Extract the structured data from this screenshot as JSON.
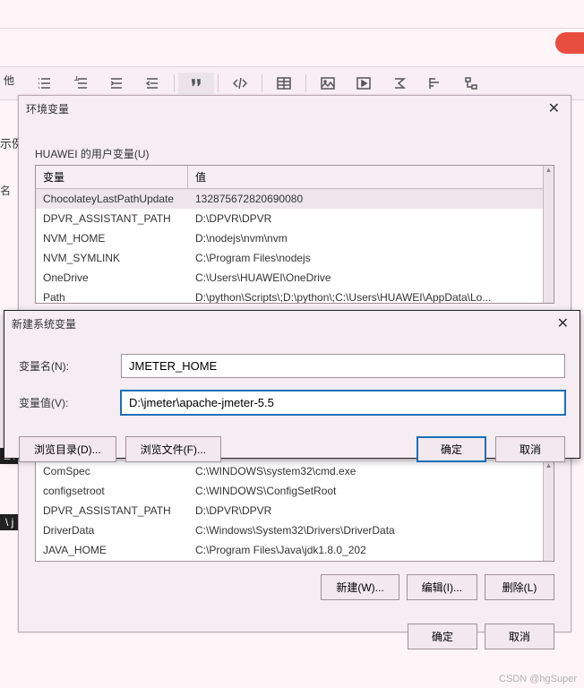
{
  "left_label_top": "他",
  "left_label_side": "示例",
  "left_dark_1": "ET",
  "left_dark_2": "\\ j",
  "left_label_3": "名",
  "dialog1": {
    "title": "环境变量",
    "user_section": "HUAWEI 的用户变量(U)",
    "headers": {
      "name": "变量",
      "value": "值"
    },
    "rows": [
      {
        "name": "ChocolateyLastPathUpdate",
        "value": "132875672820690080"
      },
      {
        "name": "DPVR_ASSISTANT_PATH",
        "value": "D:\\DPVR\\DPVR"
      },
      {
        "name": "NVM_HOME",
        "value": "D:\\nodejs\\nvm\\nvm"
      },
      {
        "name": "NVM_SYMLINK",
        "value": "C:\\Program Files\\nodejs"
      },
      {
        "name": "OneDrive",
        "value": "C:\\Users\\HUAWEI\\OneDrive"
      },
      {
        "name": "Path",
        "value": "D:\\python\\Scripts\\;D:\\python\\;C:\\Users\\HUAWEI\\AppData\\Lo..."
      }
    ],
    "sys_rows": [
      {
        "name": "ComSpec",
        "value": "C:\\WINDOWS\\system32\\cmd.exe"
      },
      {
        "name": "configsetroot",
        "value": "C:\\WINDOWS\\ConfigSetRoot"
      },
      {
        "name": "DPVR_ASSISTANT_PATH",
        "value": "D:\\DPVR\\DPVR"
      },
      {
        "name": "DriverData",
        "value": "C:\\Windows\\System32\\Drivers\\DriverData"
      },
      {
        "name": "JAVA_HOME",
        "value": "C:\\Program Files\\Java\\jdk1.8.0_202"
      }
    ],
    "btn_new": "新建(W)...",
    "btn_edit": "编辑(I)...",
    "btn_del": "删除(L)",
    "btn_ok": "确定",
    "btn_cancel": "取消"
  },
  "dialog2": {
    "title": "新建系统变量",
    "name_label": "变量名(N):",
    "name_value": "JMETER_HOME",
    "value_label": "变量值(V):",
    "value_value": "D:\\jmeter\\apache-jmeter-5.5",
    "btn_browse_dir": "浏览目录(D)...",
    "btn_browse_file": "浏览文件(F)...",
    "btn_ok": "确定",
    "btn_cancel": "取消"
  },
  "watermark": "CSDN @hgSuper"
}
